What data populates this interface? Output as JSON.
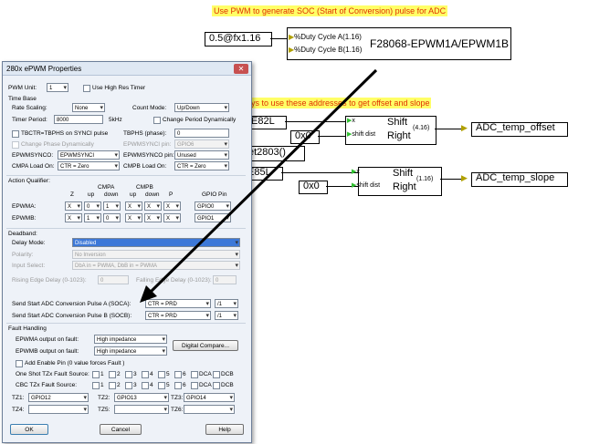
{
  "diagram": {
    "top_note": "Use PWM to generate SOC (Start of Conversion) pulse for ADC",
    "mid_note": "ays to use these addresses to get offset and slope",
    "duty_input": "0.5@fx1.16",
    "duty_a": "%Duty Cycle A(1.16)",
    "duty_b": "%Duty Cycle B(1.16)",
    "epwm_block": "F28068-EPWM1A/EPWM1B",
    "addr1": "E82L",
    "zero1": "0x0",
    "get_fn": "et2803()",
    "addr2": "E85L",
    "zero2": "0x0",
    "shift_top": "Shift",
    "shift_x": "x",
    "shift_dist": "shift dist",
    "shift_right": "Right",
    "shift_fmt1": "(4.16)",
    "shift_fmt2": "(1.16)",
    "out_offset": "ADC_temp_offset",
    "out_slope": "ADC_temp_slope"
  },
  "dialog": {
    "title": "280x ePWM Properties",
    "close_glyph": "✕",
    "pwm_unit_label": "PWM Unit:",
    "pwm_unit_value": "1",
    "high_res_label": "Use High Res Timer",
    "time_base_label": "Time Base",
    "rate_scaling_label": "Rate Scaling:",
    "rate_scaling_value": "None",
    "count_mode_label": "Count Mode:",
    "count_mode_value": "Up/Down",
    "timer_period_label": "Timer Period:",
    "timer_period_value": "8000",
    "timer_period_unit": "5kHz",
    "change_period_label": "Change Period Dynamically",
    "tbctr_label": "TBCTR=TBPHS on SYNCI pulse",
    "tbphs_label": "TBPHS (phase):",
    "tbphs_value": "0",
    "change_phase_label": "Change Phase Dynamically",
    "epwmsyncin_label": "EPWMSYNCI pin:",
    "epwmsyncin_value": "GPIO6",
    "epwmsynco_label": "EPWMSYNCO:",
    "epwmsynco_value": "EPWMSYNCI",
    "epwmsynco_pin_label": "EPWMSYNCO pin:",
    "epwmsynco_pin_value": "Unused",
    "cmpa_load_label": "CMPA Load On:",
    "cmpa_load_value": "CTR = Zero",
    "cmpb_load_label": "CMPB Load On:",
    "cmpb_load_value": "CTR = Zero",
    "aq_label": "Action Qualifier:",
    "aq_cmpa": "CMPA",
    "aq_cmpb": "CMPB",
    "aq_cols": [
      "Z",
      "up",
      "down",
      "up",
      "down",
      "P",
      "GPIO Pin"
    ],
    "epwma_label": "EPWMA:",
    "epwma_values": [
      "X",
      "0",
      "1",
      "X",
      "X",
      "X"
    ],
    "epwma_gpio": "GPIO0",
    "epwmb_label": "EPWMB:",
    "epwmb_values": [
      "X",
      "1",
      "0",
      "X",
      "X",
      "X"
    ],
    "epwmb_gpio": "GPIO1",
    "deadband_label": "Deadband:",
    "delay_mode_label": "Delay Mode:",
    "delay_mode_value": "Disabled",
    "polarity_label": "Polarity:",
    "polarity_value": "No Inversion",
    "input_select_label": "Input Select:",
    "input_select_value": "DbA in = PWMA, DbB in = PWMA",
    "rising_label": "Rising Edge Delay (0-1023):",
    "rising_value": "0",
    "falling_label": "Falling Edge Delay (0-1023):",
    "falling_value": "0",
    "soca_label": "Send Start ADC Conversion Pulse A (SOCA):",
    "soca_value": "CTR = PRD",
    "soca_div": "/1",
    "socb_label": "Send Start ADC Conversion Pulse B (SOCB):",
    "socb_value": "CTR = PRD",
    "socb_div": "/1",
    "fault_label": "Fault Handling",
    "epwma_fault_label": "EPWMA output on fault:",
    "epwma_fault_value": "High impedance",
    "epwmb_fault_label": "EPWMB output on fault:",
    "epwmb_fault_value": "High impedance",
    "digital_compare": "Digital Compare...",
    "enable_pin_label": "Add Enable Pin (0 value forces Fault )",
    "oneshot_label": "One Shot TZx Fault Source:",
    "cbc_label": "CBC TZx Fault Source:",
    "tz_sources": [
      "1",
      "2",
      "3",
      "4",
      "5",
      "6",
      "DCA",
      "DCB"
    ],
    "tz1_label": "TZ1:",
    "tz1_value": "GPIO12",
    "tz2_label": "TZ2:",
    "tz2_value": "GPIO13",
    "tz3_label": "TZ3:",
    "tz3_value": "GPIO14",
    "tz4_label": "TZ4:",
    "tz5_label": "TZ5:",
    "tz6_label": "TZ6:",
    "ok": "OK",
    "cancel": "Cancel",
    "help": "Help"
  }
}
